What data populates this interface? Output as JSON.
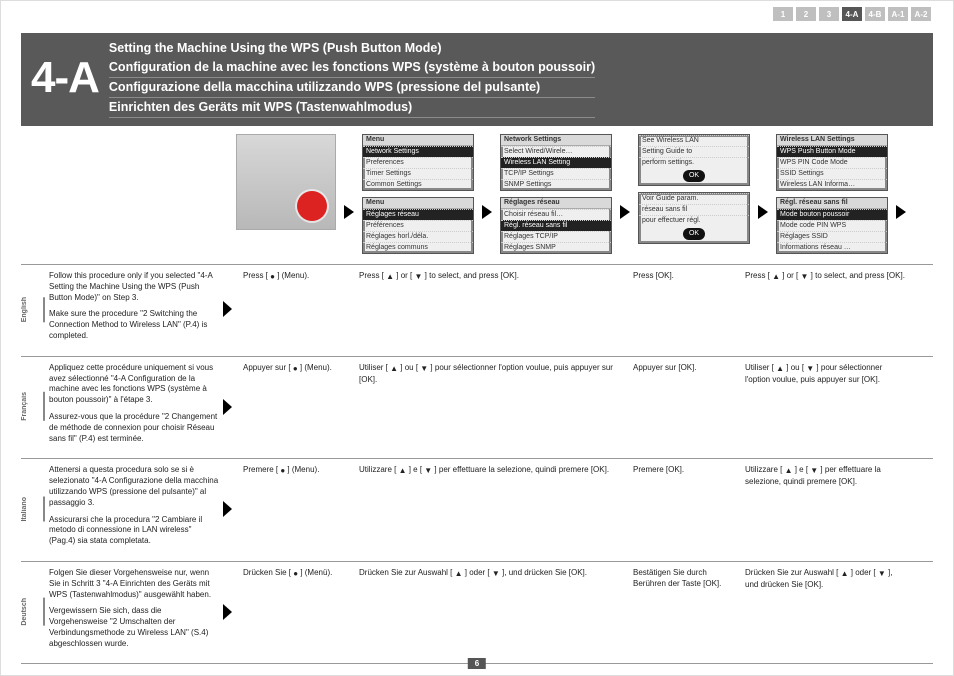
{
  "page_number": "6",
  "page_nav": {
    "items": [
      "1",
      "2",
      "3",
      "4-A",
      "4-B",
      "A-1",
      "A-2"
    ],
    "active_index": 3
  },
  "section_label": "4-A",
  "titles": {
    "en": "Setting the Machine Using the WPS (Push Button Mode)",
    "fr": "Configuration de la machine avec les fonctions WPS (système à bouton poussoir)",
    "it": "Configurazione della macchina utilizzando WPS (pressione del pulsante)",
    "de": "Einrichten des Geräts mit WPS (Tastenwahlmodus)"
  },
  "screens": {
    "menu_en": {
      "cap": "Menu",
      "rows": [
        "Network Settings",
        "Preferences",
        "Timer Settings",
        "Common Settings"
      ],
      "sel": 0
    },
    "menu_fr": {
      "cap": "Menu",
      "rows": [
        "Réglages réseau",
        "Préférences",
        "Réglages horl./déla.",
        "Réglages communs"
      ],
      "sel": 0
    },
    "net_en": {
      "cap": "Network Settings",
      "rows": [
        "Select Wired/Wirele…",
        "Wireless LAN Setting",
        "TCP/IP Settings",
        "SNMP Settings"
      ],
      "sel": 1
    },
    "net_fr": {
      "cap": "Réglages réseau",
      "rows": [
        "Choisir réseau fil…",
        "Régl. réseau sans fil",
        "Réglages TCP/IP",
        "Réglages SNMP"
      ],
      "sel": 1
    },
    "guide_en": {
      "cap": "",
      "rows": [
        "See Wireless LAN",
        "Setting Guide to",
        "perform settings."
      ],
      "ok": "OK"
    },
    "guide_fr": {
      "cap": "",
      "rows": [
        "Voir Guide param.",
        "réseau sans fil",
        "pour effectuer régl."
      ],
      "ok": "OK"
    },
    "wlan_en": {
      "cap": "Wireless LAN Settings",
      "rows": [
        "WPS Push Button Mode",
        "WPS PIN Code Mode",
        "SSID Settings",
        "Wireless LAN Informa…"
      ],
      "sel": 0
    },
    "wlan_fr": {
      "cap": "Régl. réseau sans fil",
      "rows": [
        "Mode bouton poussoir",
        "Mode code PIN WPS",
        "Réglages SSID",
        "Informations réseau …"
      ],
      "sel": 0
    }
  },
  "labels": {
    "menu_icon": "●",
    "up": "▲",
    "down": "▼"
  },
  "instructions": {
    "english": {
      "lang": "English",
      "c0a": "Follow this procedure only if you selected \"4-A Setting the Machine Using the WPS (Push Button Mode)\" on Step 3.",
      "c0b": "Make sure the procedure \"2 Switching the Connection Method to Wireless LAN\" (P.4) is completed.",
      "c1a": "Press [ ",
      "c1b": " ] (Menu).",
      "c2a": "Press [ ",
      "c2b": " ] or [ ",
      "c2c": " ] to select, and press [OK].",
      "c3": "Press [OK].",
      "c4a": "Press [ ",
      "c4b": " ] or [ ",
      "c4c": " ] to select, and press [OK]."
    },
    "francais": {
      "lang": "Français",
      "c0a": "Appliquez cette procédure uniquement si vous avez sélectionné \"4-A Configuration de la machine avec les fonctions WPS (système à bouton poussoir)\" à l'étape 3.",
      "c0b": "Assurez-vous que la procédure \"2 Changement de méthode de connexion pour choisir Réseau sans fil\" (P.4) est terminée.",
      "c1a": "Appuyer sur [ ",
      "c1b": " ] (Menu).",
      "c2a": "Utiliser [ ",
      "c2b": " ] ou [ ",
      "c2c": " ] pour sélectionner l'option voulue, puis appuyer sur [OK].",
      "c3": "Appuyer sur [OK].",
      "c4a": "Utiliser [ ",
      "c4b": " ] ou [ ",
      "c4c": " ] pour sélectionner l'option voulue, puis appuyer sur [OK]."
    },
    "italiano": {
      "lang": "Italiano",
      "c0a": "Attenersi a questa procedura solo se si è selezionato \"4-A Configurazione della macchina utilizzando WPS (pressione del pulsante)\" al passaggio 3.",
      "c0b": "Assicurarsi che la procedura \"2 Cambiare il metodo di connessione in LAN wireless\" (Pag.4) sia stata completata.",
      "c1a": "Premere [ ",
      "c1b": " ] (Menu).",
      "c2a": "Utilizzare [ ",
      "c2b": " ] e [ ",
      "c2c": " ] per effettuare la selezione, quindi premere [OK].",
      "c3": "Premere [OK].",
      "c4a": "Utilizzare [ ",
      "c4b": " ] e [ ",
      "c4c": " ] per effettuare la selezione, quindi premere [OK]."
    },
    "deutsch": {
      "lang": "Deutsch",
      "c0a": "Folgen Sie dieser Vorgehensweise nur, wenn Sie in Schritt 3 \"4-A Einrichten des Geräts mit WPS (Tastenwahlmodus)\" ausgewählt haben.",
      "c0b": "Vergewissern Sie sich, dass die Vorgehensweise \"2 Umschalten der Verbindungsmethode zu Wireless LAN\" (S.4) abgeschlossen wurde.",
      "c1a": "Drücken Sie [ ",
      "c1b": " ] (Menü).",
      "c2a": "Drücken Sie zur Auswahl [ ",
      "c2b": " ] oder [ ",
      "c2c": " ], und drücken Sie [OK].",
      "c3": "Bestätigen Sie durch Berühren der Taste [OK].",
      "c4a": "Drücken Sie zur Auswahl [ ",
      "c4b": " ] oder [ ",
      "c4c": " ], und drücken Sie [OK]."
    }
  }
}
